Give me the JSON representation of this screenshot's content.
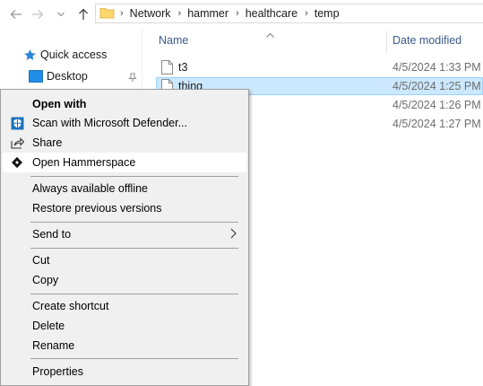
{
  "address": {
    "breadcrumbs": [
      "Network",
      "hammer",
      "healthcare",
      "temp"
    ]
  },
  "nav": {
    "quick_access": "Quick access",
    "desktop": "Desktop"
  },
  "columns": {
    "name": "Name",
    "date_modified": "Date modified"
  },
  "files": [
    {
      "name": "t3",
      "date": "4/5/2024 1:33 PM"
    },
    {
      "name": "thing",
      "date": "4/5/2024 1:25 PM"
    },
    {
      "name": "",
      "date": "4/5/2024 1:26 PM"
    },
    {
      "name": "",
      "date": "4/5/2024 1:27 PM"
    }
  ],
  "context_menu": {
    "open_with": "Open with",
    "scan": "Scan with Microsoft Defender...",
    "share": "Share",
    "open_hammerspace": "Open Hammerspace",
    "always_offline": "Always available offline",
    "restore": "Restore previous versions",
    "send_to": "Send to",
    "cut": "Cut",
    "copy": "Copy",
    "create_shortcut": "Create shortcut",
    "delete": "Delete",
    "rename": "Rename",
    "properties": "Properties"
  },
  "colors": {
    "selection_bg": "#cce8ff",
    "selection_border": "#99d1ff",
    "menu_bg": "#f0f0f0",
    "header_text": "#3a5a8c"
  }
}
